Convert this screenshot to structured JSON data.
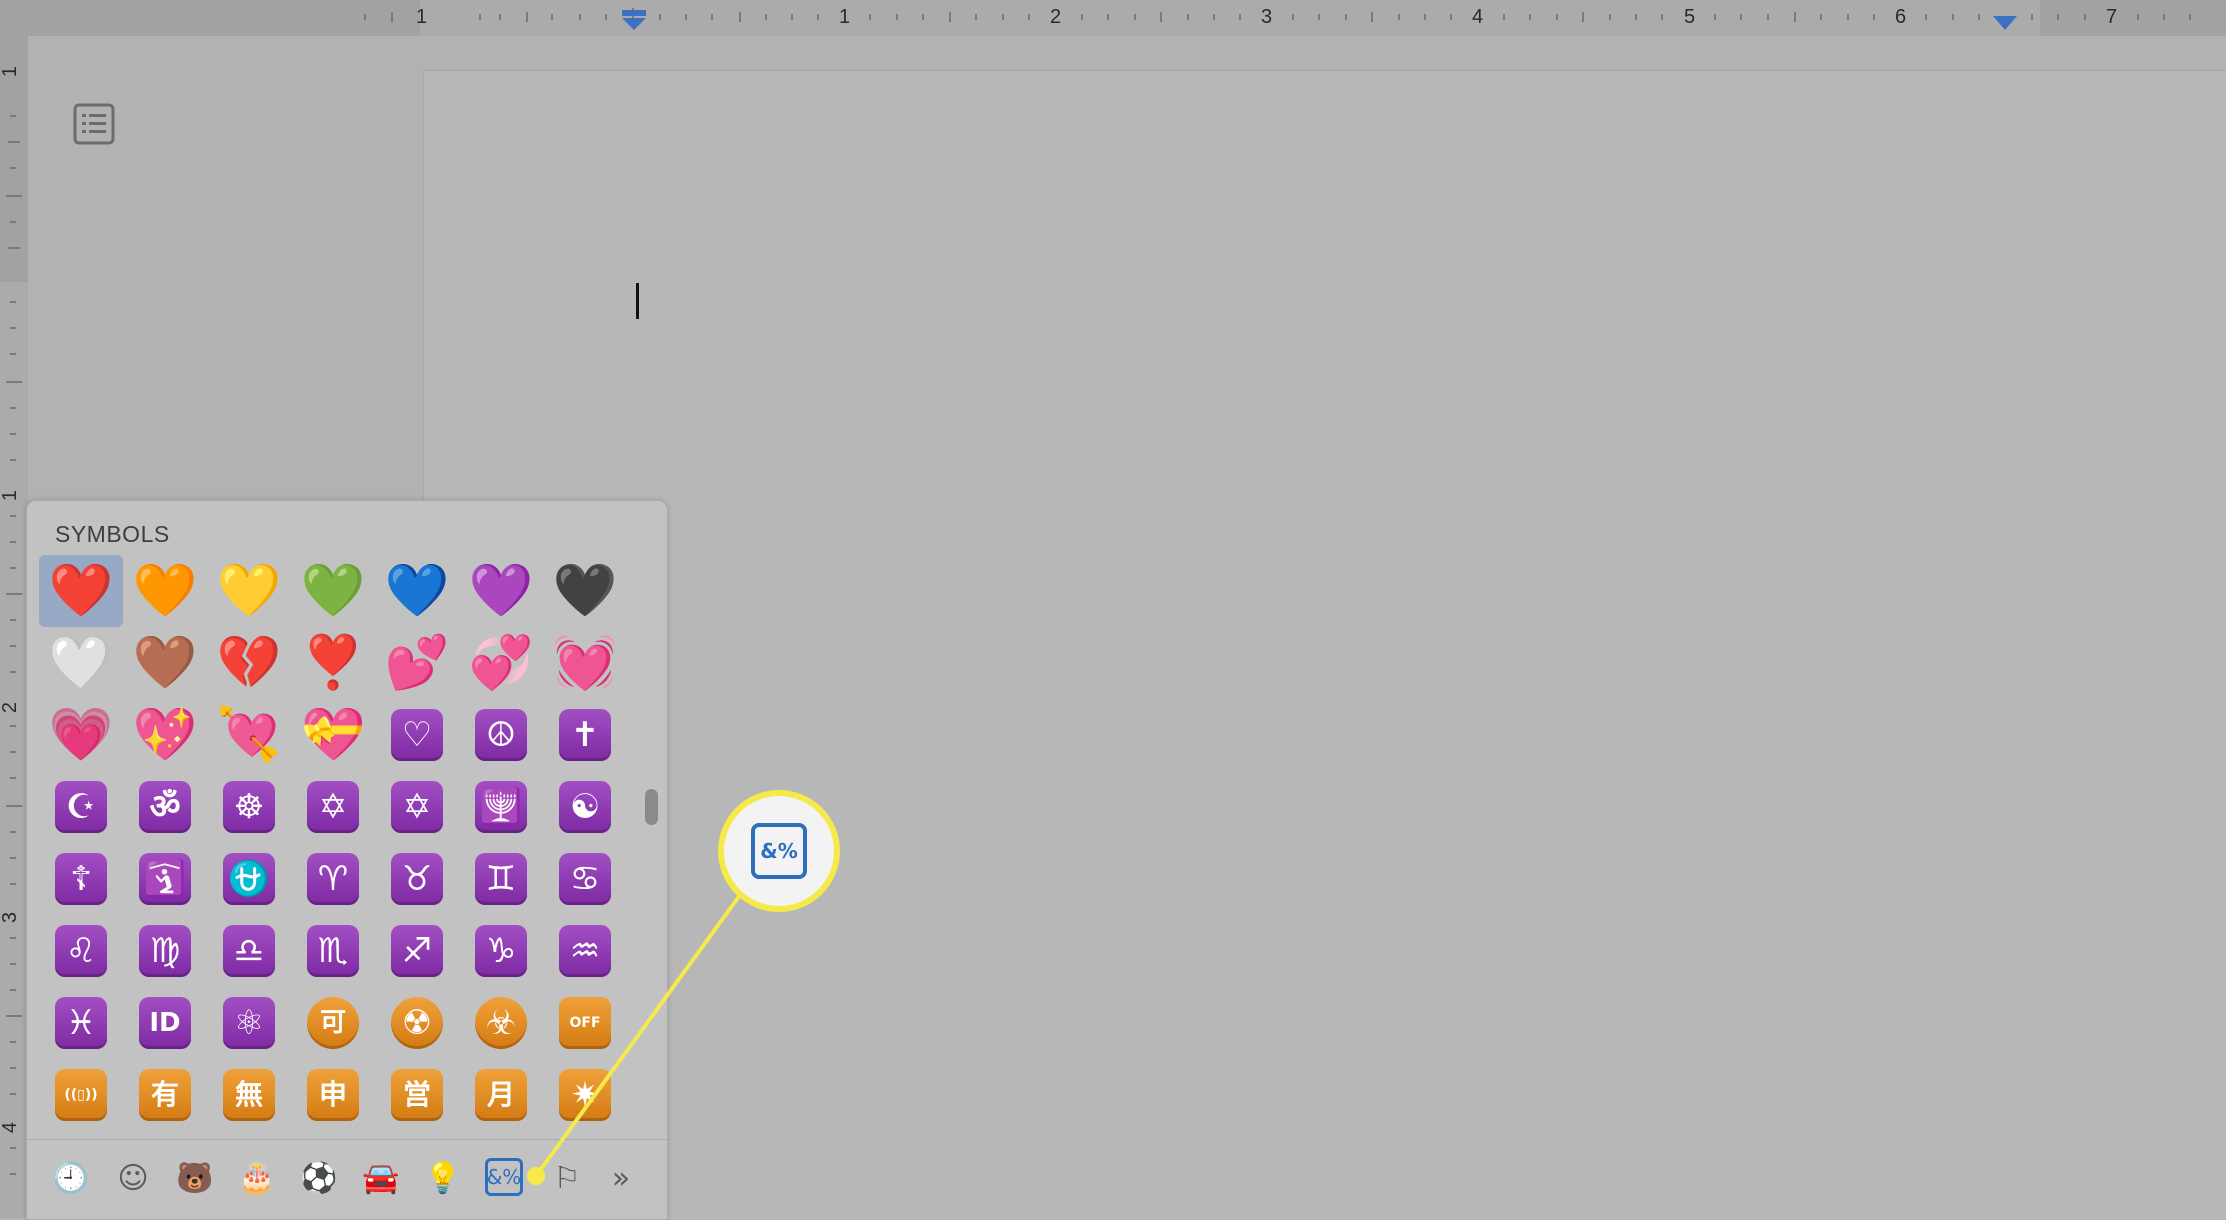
{
  "ruler": {
    "top_numbers": [
      "1",
      "1",
      "2",
      "3",
      "4",
      "5",
      "6",
      "7"
    ],
    "left_numbers": [
      "1",
      "1",
      "2",
      "3",
      "4"
    ]
  },
  "sidebar": {
    "outline_icon": "document-outline-icon"
  },
  "picker": {
    "section_title": "SYMBOLS",
    "rows": [
      [
        "❤️",
        "🧡",
        "💛",
        "💚",
        "💙",
        "💜",
        "🖤"
      ],
      [
        "🤍",
        "🤎",
        "💔",
        "❣️",
        "💕",
        "💞",
        "💓"
      ],
      [
        "💗",
        "💖",
        "💘",
        "💝",
        "♡",
        "☮",
        "✝"
      ],
      [
        "☪",
        "ॐ",
        "☸",
        "✡",
        "✡",
        "🕎",
        "☯"
      ],
      [
        "☦",
        "🛐",
        "⛎",
        "♈",
        "♉",
        "♊",
        "♋"
      ],
      [
        "♌",
        "♍",
        "♎",
        "♏",
        "♐",
        "♑",
        "♒"
      ],
      [
        "♓",
        "ID",
        "⚛",
        "可",
        "☢",
        "☣",
        "OFF"
      ],
      [
        "((▯))",
        "有",
        "無",
        "申",
        "営",
        "月",
        "✷"
      ]
    ],
    "tabs": [
      {
        "name": "recent-tab",
        "icon": "clock-icon",
        "glyph": "🕘"
      },
      {
        "name": "smileys-tab",
        "icon": "smiley-icon",
        "glyph": "☺"
      },
      {
        "name": "animals-tab",
        "icon": "bear-icon",
        "glyph": "🐻"
      },
      {
        "name": "food-tab",
        "icon": "cake-icon",
        "glyph": "🎂"
      },
      {
        "name": "activity-tab",
        "icon": "ball-icon",
        "glyph": "⚽"
      },
      {
        "name": "travel-tab",
        "icon": "car-icon",
        "glyph": "🚘"
      },
      {
        "name": "objects-tab",
        "icon": "lightbulb-icon",
        "glyph": "💡"
      },
      {
        "name": "symbols-tab",
        "icon": "symbols-icon",
        "glyph": "&%"
      },
      {
        "name": "flags-tab",
        "icon": "flag-icon",
        "glyph": "⚐"
      },
      {
        "name": "more-tab",
        "icon": "chevron-double-right-icon",
        "glyph": "»"
      }
    ]
  },
  "callout": {
    "icon": "symbols-icon",
    "glyph": "&%",
    "accent": "#f6ea4b",
    "icon_color": "#2c6fbd"
  },
  "colors": {
    "selection": "#98a9c5",
    "active_tab": "#2c6fbd"
  }
}
